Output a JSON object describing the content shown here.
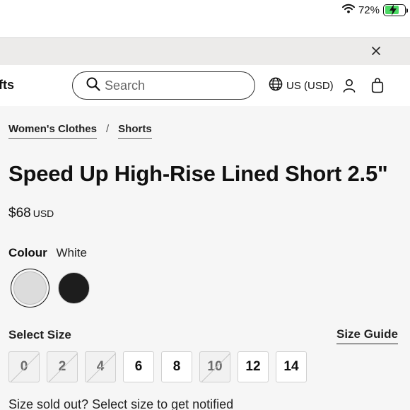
{
  "status_bar": {
    "battery_text": "72%",
    "battery_level": 0.72,
    "battery_color": "#4cd964"
  },
  "promo_bar": {
    "close_icon": "close-icon"
  },
  "header": {
    "nav_partial": "fts",
    "search": {
      "placeholder": "Search",
      "value": ""
    },
    "locale_label": "US (USD)",
    "icons": [
      "search-icon",
      "globe-icon",
      "account-icon",
      "bag-icon"
    ]
  },
  "breadcrumb": {
    "items": [
      "Women's Clothes",
      "Shorts"
    ],
    "separator": "/"
  },
  "product": {
    "title": "Speed Up High-Rise Lined Short 2.5\"",
    "price": "$68",
    "currency": "USD",
    "colour": {
      "label": "Colour",
      "selected": "White",
      "swatches": [
        {
          "name": "White",
          "hex": "#dcdcdc",
          "selected": true
        },
        {
          "name": "Black",
          "hex": "#1d1d1d",
          "selected": false
        }
      ]
    },
    "size": {
      "title": "Select Size",
      "guide_label": "Size Guide",
      "options": [
        {
          "label": "0",
          "available": false
        },
        {
          "label": "2",
          "available": false
        },
        {
          "label": "4",
          "available": false
        },
        {
          "label": "6",
          "available": true
        },
        {
          "label": "8",
          "available": true
        },
        {
          "label": "10",
          "available": false
        },
        {
          "label": "12",
          "available": true
        },
        {
          "label": "14",
          "available": true
        }
      ],
      "sold_out_note": "Size sold out? Select size to get notified"
    }
  }
}
